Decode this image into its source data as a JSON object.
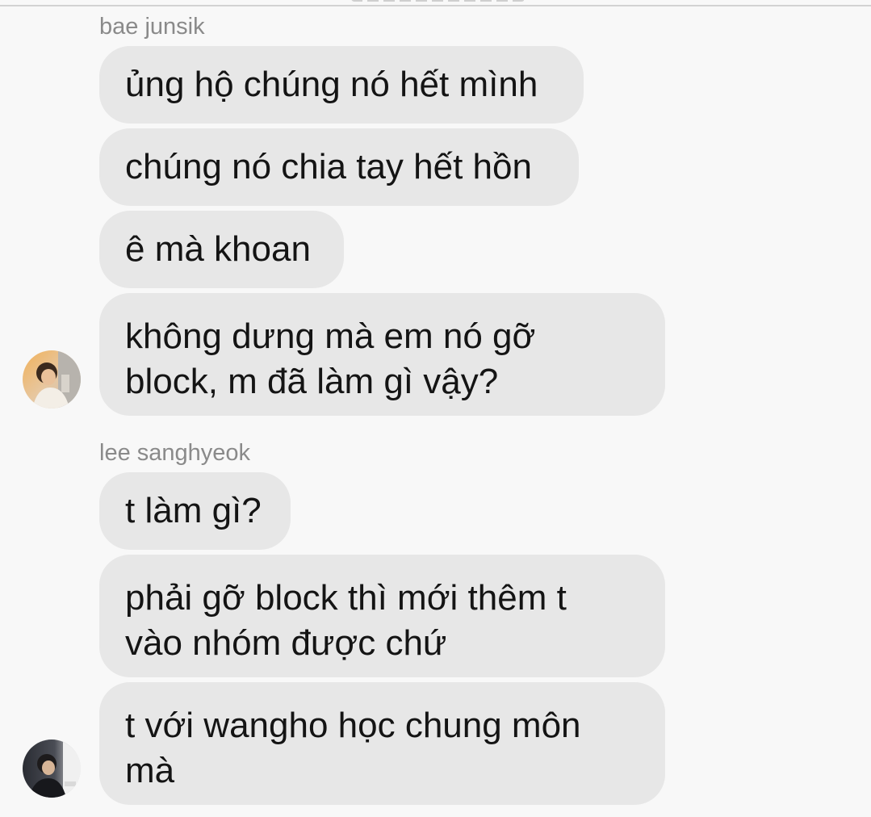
{
  "conversation": {
    "groups": [
      {
        "sender": "bae junsik",
        "messages": [
          "ủng hộ chúng nó hết mình",
          "chúng nó chia tay hết hồn",
          "ê mà khoan",
          "không dưng mà em nó gỡ\nblock, m đã làm gì vậy?"
        ],
        "avatar_icon": "avatar-photo-icon"
      },
      {
        "sender": "lee sanghyeok",
        "messages": [
          "t làm gì?",
          "phải gỡ block thì mới thêm t\nvào nhóm được chứ",
          "t với wangho học chung môn\nmà"
        ],
        "avatar_icon": "avatar-photo-icon"
      }
    ]
  },
  "colors": {
    "background": "#f8f8f8",
    "bubble": "#e7e7e7",
    "sender_name": "#8a8a8a",
    "message_text": "#141414"
  }
}
